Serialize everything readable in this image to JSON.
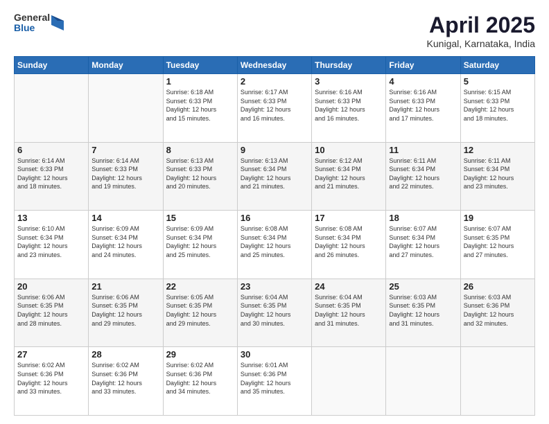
{
  "header": {
    "logo_general": "General",
    "logo_blue": "Blue",
    "month_title": "April 2025",
    "location": "Kunigal, Karnataka, India"
  },
  "weekdays": [
    "Sunday",
    "Monday",
    "Tuesday",
    "Wednesday",
    "Thursday",
    "Friday",
    "Saturday"
  ],
  "weeks": [
    [
      {
        "day": "",
        "info": ""
      },
      {
        "day": "",
        "info": ""
      },
      {
        "day": "1",
        "info": "Sunrise: 6:18 AM\nSunset: 6:33 PM\nDaylight: 12 hours\nand 15 minutes."
      },
      {
        "day": "2",
        "info": "Sunrise: 6:17 AM\nSunset: 6:33 PM\nDaylight: 12 hours\nand 16 minutes."
      },
      {
        "day": "3",
        "info": "Sunrise: 6:16 AM\nSunset: 6:33 PM\nDaylight: 12 hours\nand 16 minutes."
      },
      {
        "day": "4",
        "info": "Sunrise: 6:16 AM\nSunset: 6:33 PM\nDaylight: 12 hours\nand 17 minutes."
      },
      {
        "day": "5",
        "info": "Sunrise: 6:15 AM\nSunset: 6:33 PM\nDaylight: 12 hours\nand 18 minutes."
      }
    ],
    [
      {
        "day": "6",
        "info": "Sunrise: 6:14 AM\nSunset: 6:33 PM\nDaylight: 12 hours\nand 18 minutes."
      },
      {
        "day": "7",
        "info": "Sunrise: 6:14 AM\nSunset: 6:33 PM\nDaylight: 12 hours\nand 19 minutes."
      },
      {
        "day": "8",
        "info": "Sunrise: 6:13 AM\nSunset: 6:33 PM\nDaylight: 12 hours\nand 20 minutes."
      },
      {
        "day": "9",
        "info": "Sunrise: 6:13 AM\nSunset: 6:34 PM\nDaylight: 12 hours\nand 21 minutes."
      },
      {
        "day": "10",
        "info": "Sunrise: 6:12 AM\nSunset: 6:34 PM\nDaylight: 12 hours\nand 21 minutes."
      },
      {
        "day": "11",
        "info": "Sunrise: 6:11 AM\nSunset: 6:34 PM\nDaylight: 12 hours\nand 22 minutes."
      },
      {
        "day": "12",
        "info": "Sunrise: 6:11 AM\nSunset: 6:34 PM\nDaylight: 12 hours\nand 23 minutes."
      }
    ],
    [
      {
        "day": "13",
        "info": "Sunrise: 6:10 AM\nSunset: 6:34 PM\nDaylight: 12 hours\nand 23 minutes."
      },
      {
        "day": "14",
        "info": "Sunrise: 6:09 AM\nSunset: 6:34 PM\nDaylight: 12 hours\nand 24 minutes."
      },
      {
        "day": "15",
        "info": "Sunrise: 6:09 AM\nSunset: 6:34 PM\nDaylight: 12 hours\nand 25 minutes."
      },
      {
        "day": "16",
        "info": "Sunrise: 6:08 AM\nSunset: 6:34 PM\nDaylight: 12 hours\nand 25 minutes."
      },
      {
        "day": "17",
        "info": "Sunrise: 6:08 AM\nSunset: 6:34 PM\nDaylight: 12 hours\nand 26 minutes."
      },
      {
        "day": "18",
        "info": "Sunrise: 6:07 AM\nSunset: 6:34 PM\nDaylight: 12 hours\nand 27 minutes."
      },
      {
        "day": "19",
        "info": "Sunrise: 6:07 AM\nSunset: 6:35 PM\nDaylight: 12 hours\nand 27 minutes."
      }
    ],
    [
      {
        "day": "20",
        "info": "Sunrise: 6:06 AM\nSunset: 6:35 PM\nDaylight: 12 hours\nand 28 minutes."
      },
      {
        "day": "21",
        "info": "Sunrise: 6:06 AM\nSunset: 6:35 PM\nDaylight: 12 hours\nand 29 minutes."
      },
      {
        "day": "22",
        "info": "Sunrise: 6:05 AM\nSunset: 6:35 PM\nDaylight: 12 hours\nand 29 minutes."
      },
      {
        "day": "23",
        "info": "Sunrise: 6:04 AM\nSunset: 6:35 PM\nDaylight: 12 hours\nand 30 minutes."
      },
      {
        "day": "24",
        "info": "Sunrise: 6:04 AM\nSunset: 6:35 PM\nDaylight: 12 hours\nand 31 minutes."
      },
      {
        "day": "25",
        "info": "Sunrise: 6:03 AM\nSunset: 6:35 PM\nDaylight: 12 hours\nand 31 minutes."
      },
      {
        "day": "26",
        "info": "Sunrise: 6:03 AM\nSunset: 6:36 PM\nDaylight: 12 hours\nand 32 minutes."
      }
    ],
    [
      {
        "day": "27",
        "info": "Sunrise: 6:02 AM\nSunset: 6:36 PM\nDaylight: 12 hours\nand 33 minutes."
      },
      {
        "day": "28",
        "info": "Sunrise: 6:02 AM\nSunset: 6:36 PM\nDaylight: 12 hours\nand 33 minutes."
      },
      {
        "day": "29",
        "info": "Sunrise: 6:02 AM\nSunset: 6:36 PM\nDaylight: 12 hours\nand 34 minutes."
      },
      {
        "day": "30",
        "info": "Sunrise: 6:01 AM\nSunset: 6:36 PM\nDaylight: 12 hours\nand 35 minutes."
      },
      {
        "day": "",
        "info": ""
      },
      {
        "day": "",
        "info": ""
      },
      {
        "day": "",
        "info": ""
      }
    ]
  ]
}
